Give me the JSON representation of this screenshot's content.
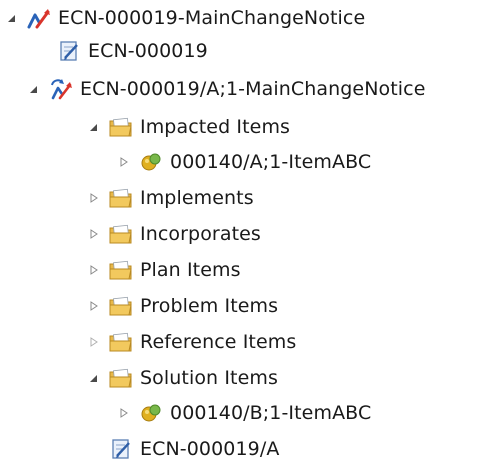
{
  "tree": {
    "root": {
      "label": "ECN-000019-MainChangeNotice",
      "icon": "change-notice-icon",
      "expanded": true
    },
    "doc1": {
      "label": "ECN-000019",
      "icon": "document-edit-icon"
    },
    "rev": {
      "label": "ECN-000019/A;1-MainChangeNotice",
      "icon": "change-notice-revision-icon",
      "expanded": true
    },
    "impacted": {
      "label": "Impacted Items",
      "icon": "folder-icon",
      "expanded": true
    },
    "item1": {
      "label": "000140/A;1-ItemABC",
      "icon": "item-icon",
      "expanded": false
    },
    "implements": {
      "label": "Implements",
      "icon": "folder-icon",
      "expanded": false
    },
    "incorporates": {
      "label": "Incorporates",
      "icon": "folder-icon",
      "expanded": false
    },
    "plan": {
      "label": "Plan Items",
      "icon": "folder-icon",
      "expanded": false
    },
    "problem": {
      "label": "Problem Items",
      "icon": "folder-icon",
      "expanded": false
    },
    "reference": {
      "label": "Reference Items",
      "icon": "folder-icon",
      "expanded": false
    },
    "solution": {
      "label": "Solution Items",
      "icon": "folder-icon",
      "expanded": true
    },
    "item2": {
      "label": "000140/B;1-ItemABC",
      "icon": "item-icon",
      "expanded": false
    },
    "doc2": {
      "label": "ECN-000019/A",
      "icon": "document-edit-icon"
    }
  },
  "colors": {
    "folder": "#e8b84a",
    "folder_dark": "#b98a22",
    "item": "#e0b020",
    "item_green": "#79b84a",
    "change_blue": "#2a63b8",
    "change_red": "#d9342b",
    "twisty": "#5a5a5a"
  }
}
